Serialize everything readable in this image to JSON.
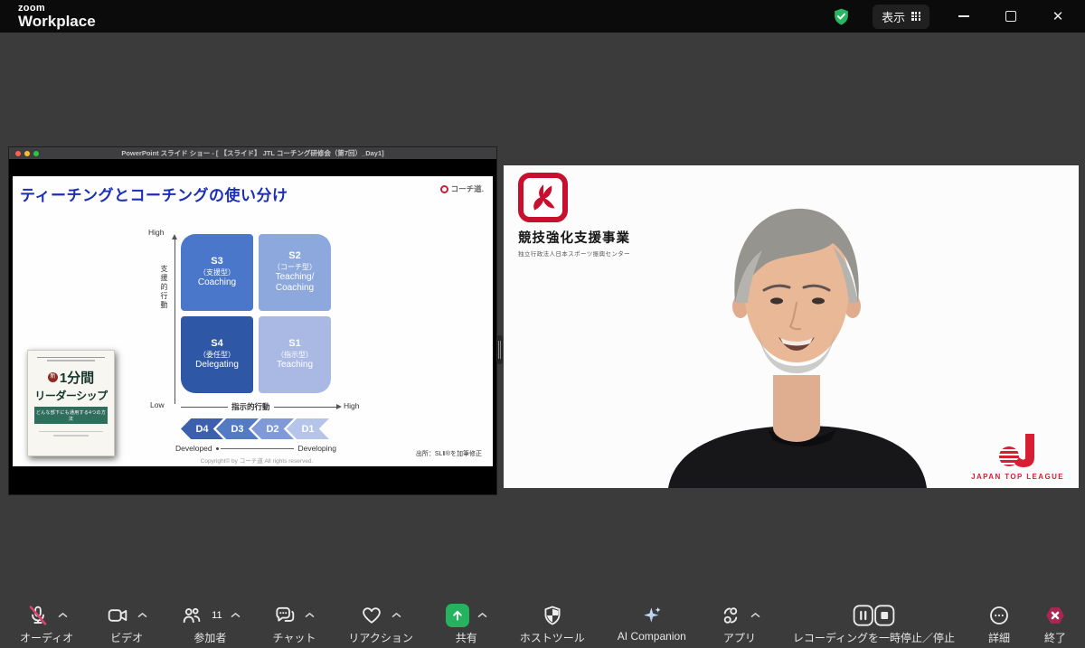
{
  "window": {
    "brand_small": "zoom",
    "brand_large": "Workplace",
    "view_button": "表示"
  },
  "shared_screen": {
    "window_title": "PowerPoint スライド ショー - [ 【スライド】 JTL コーチング研修会（第7回）_Day1]",
    "slide": {
      "title": "ティーチングとコーチングの使い分け",
      "brand": "コーチ道.",
      "book": {
        "badge": "新",
        "title1": "1分間",
        "title2": "リーダーシップ",
        "band": "どんな部下にも通用する4つの方法"
      },
      "matrix": {
        "y_high": "High",
        "y_low": "Low",
        "y_label": "支援的行動",
        "x_low": "Low",
        "x_high": "High",
        "x_label": "指示的行動",
        "quadrants": [
          {
            "code": "S3",
            "type": "（支援型）",
            "style": "Coaching",
            "color": "#4a77c9",
            "corner": "tl"
          },
          {
            "code": "S2",
            "type": "（コーチ型）",
            "style": "Teaching/Coaching",
            "color": "#8da8dc",
            "corner": "tr"
          },
          {
            "code": "S4",
            "type": "（委任型）",
            "style": "Delegating",
            "color": "#2e57a5",
            "corner": "bl"
          },
          {
            "code": "S1",
            "type": "（指示型）",
            "style": "Teaching",
            "color": "#aab9e4",
            "corner": "br"
          }
        ]
      },
      "dband": {
        "levels": [
          {
            "label": "D4",
            "color": "#3c60ae"
          },
          {
            "label": "D3",
            "color": "#547ac4"
          },
          {
            "label": "D2",
            "color": "#7f9ad6"
          },
          {
            "label": "D1",
            "color": "#b5c4e8"
          }
        ],
        "left": "Developed",
        "right": "Developing"
      },
      "source": "出所：SLⅡ®を加筆修正",
      "copyright": "Copyright© by コーチ道 All rights reserved."
    }
  },
  "participant_video": {
    "program_title": "競技強化支援事業",
    "program_subtitle": "独立行政法人日本スポーツ振興センター",
    "league": "JAPAN TOP LEAGUE"
  },
  "toolbar": {
    "items": [
      {
        "id": "audio",
        "label": "オーディオ",
        "icon": "mic-muted",
        "chevron": true
      },
      {
        "id": "video",
        "label": "ビデオ",
        "icon": "camera",
        "chevron": true
      },
      {
        "id": "participants",
        "label": "参加者",
        "icon": "people",
        "badge": "11",
        "chevron": true
      },
      {
        "id": "chat",
        "label": "チャット",
        "icon": "chat",
        "chevron": true
      },
      {
        "id": "reactions",
        "label": "リアクション",
        "icon": "heart",
        "chevron": true
      },
      {
        "id": "share",
        "label": "共有",
        "icon": "share",
        "chevron": true
      },
      {
        "id": "host-tools",
        "label": "ホストツール",
        "icon": "shield"
      },
      {
        "id": "ai-companion",
        "label": "AI Companion",
        "icon": "sparkle"
      },
      {
        "id": "apps",
        "label": "アプリ",
        "icon": "apps",
        "chevron": true
      },
      {
        "id": "recording",
        "label": "レコーディングを一時停止／停止",
        "icon": "pause-stop"
      },
      {
        "id": "more",
        "label": "詳細",
        "icon": "ellipsis"
      },
      {
        "id": "end",
        "label": "終了",
        "icon": "end-x"
      }
    ]
  },
  "colors": {
    "topbar": "#0b0b0b",
    "background": "#3b3b3b",
    "share_green": "#26b35f",
    "end_red": "#ab2753",
    "mute_slash_red": "#e0426d",
    "security_green": "#2ab561",
    "slide_title_blue": "#1b2fb5",
    "org_logo_red": "#c8102e",
    "league_red": "#d61f33"
  }
}
